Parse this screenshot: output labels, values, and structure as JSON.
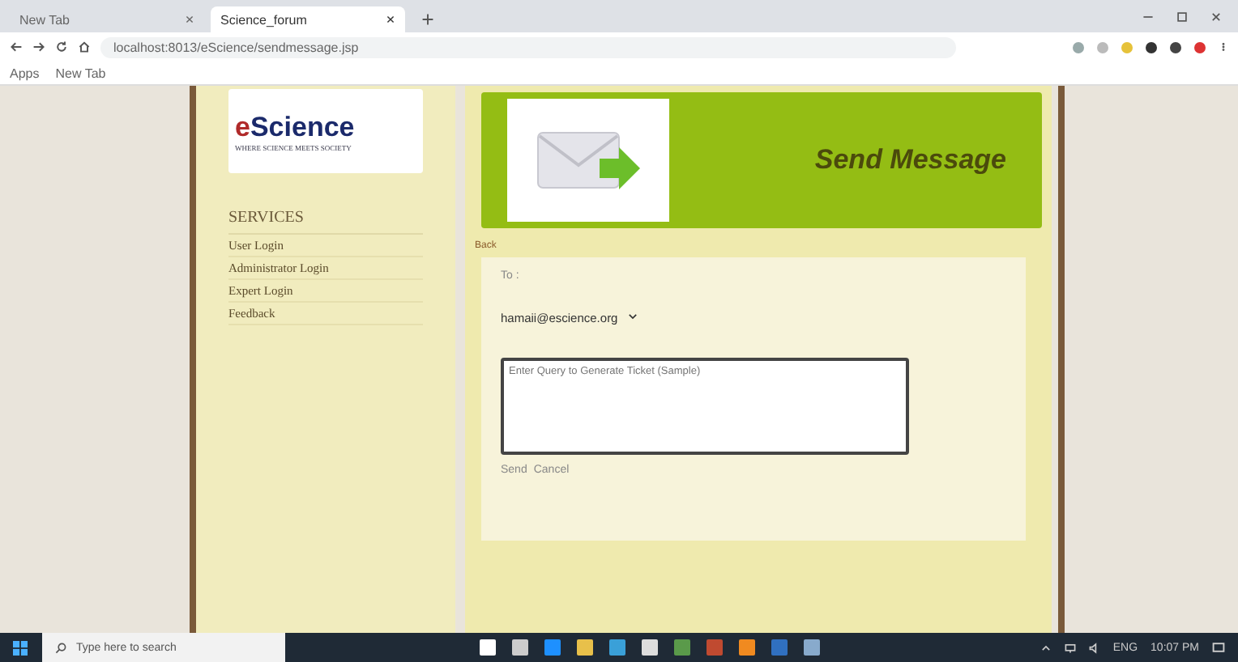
{
  "browser": {
    "tabs": [
      {
        "label": "New Tab",
        "selected": false
      },
      {
        "label": "Science_forum",
        "selected": true
      }
    ],
    "address": "localhost:8013/eScience/sendmessage.jsp",
    "bookmarks": [
      "Apps",
      "New Tab"
    ]
  },
  "sidebar": {
    "logo": {
      "prefix": "e",
      "title": "Science",
      "tagline": "WHERE SCIENCE MEETS SOCIETY"
    },
    "heading": "SERVICES",
    "items": [
      "User Login",
      "Administrator Login",
      "Expert Login",
      "Feedback"
    ]
  },
  "header": {
    "title": "Send Message"
  },
  "form": {
    "back": "Back",
    "to_label": "To :",
    "recipient": "hamaii@escience.org",
    "placeholder": "Enter Query to Generate Ticket (Sample)",
    "actions": [
      "Send",
      "Cancel"
    ]
  },
  "taskbar": {
    "search_placeholder": "Type here to search",
    "language": "ENG",
    "time": "10:07 PM"
  }
}
